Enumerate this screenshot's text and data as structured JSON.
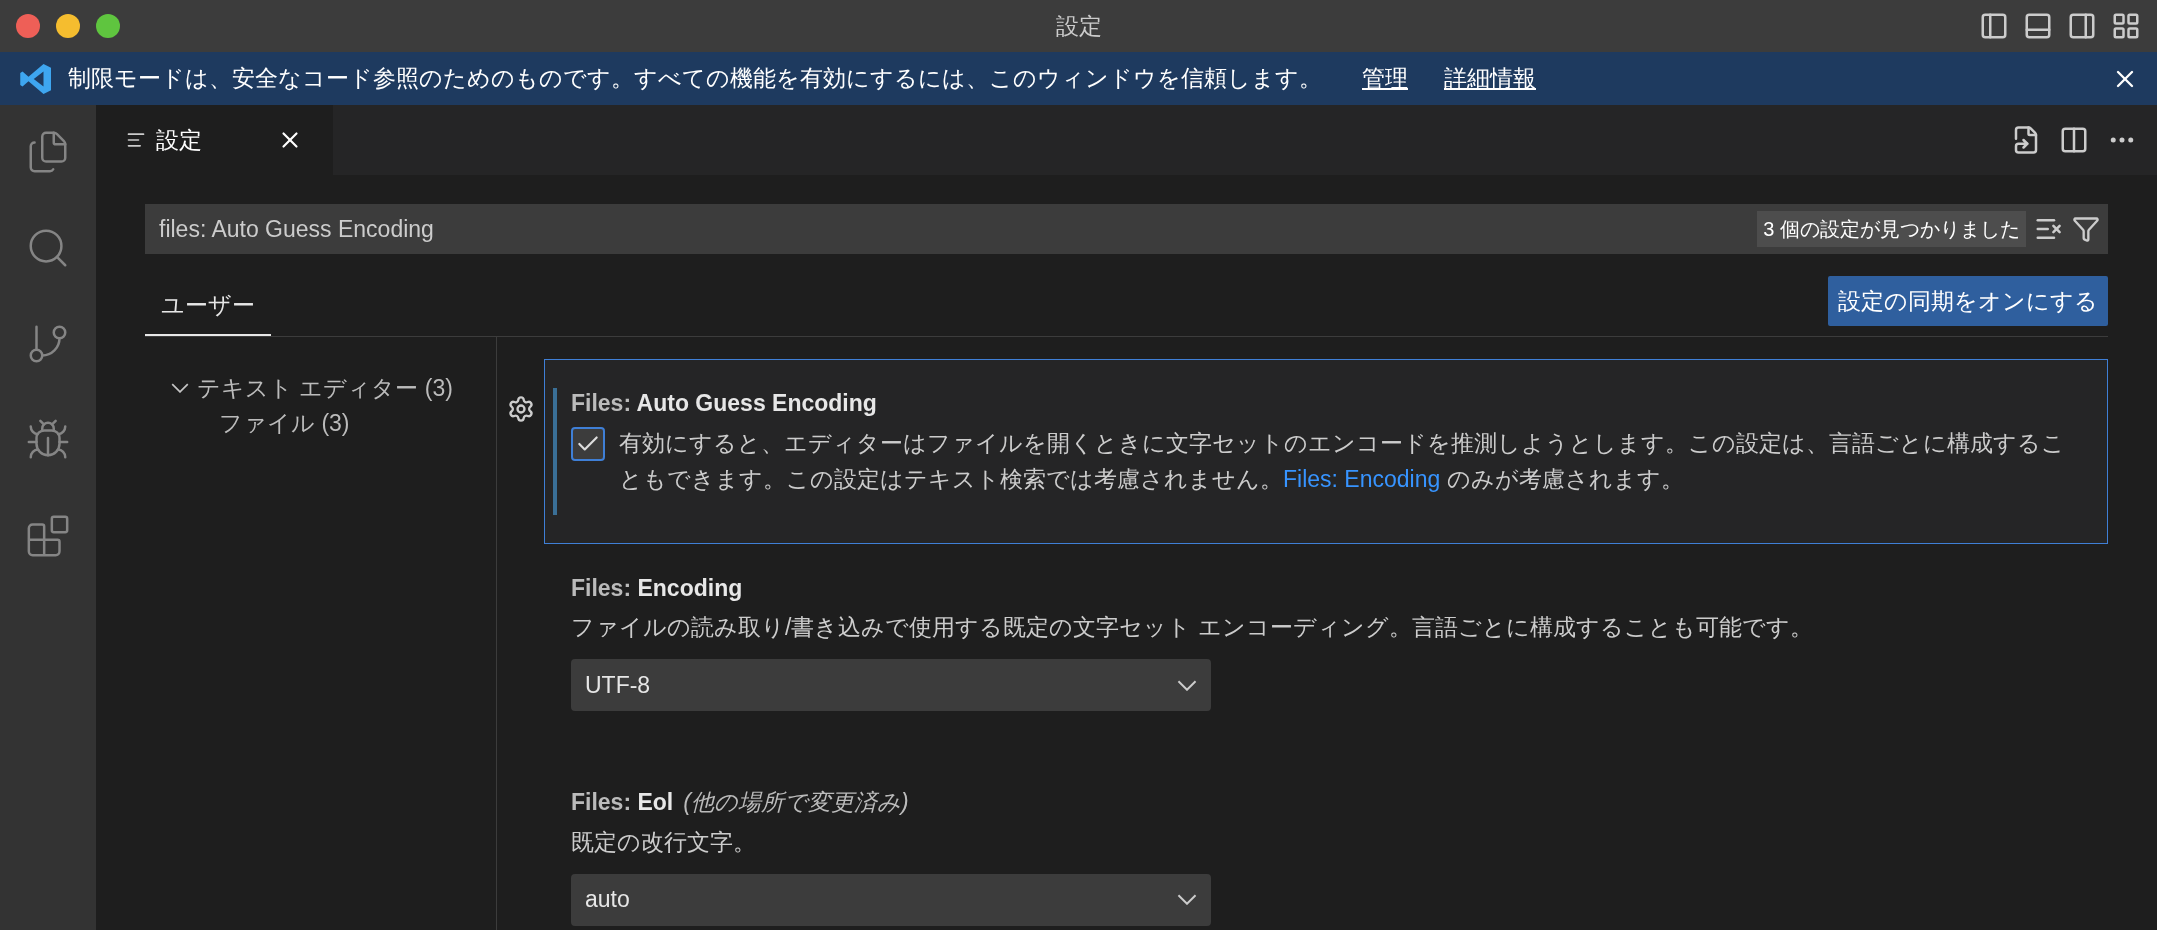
{
  "window": {
    "title": "設定"
  },
  "banner": {
    "message": "制限モードは、安全なコード参照のためのものです。すべての機能を有効にするには、このウィンドウを信頼します。",
    "links": [
      "管理",
      "詳細情報"
    ]
  },
  "editor_tab": {
    "label": "設定"
  },
  "search": {
    "value": "files: Auto Guess Encoding",
    "result_count": "3 個の設定が見つかりました"
  },
  "scope_tabs": [
    {
      "label": "ユーザー",
      "selected": true
    }
  ],
  "sync_button": "設定の同期をオンにする",
  "tree": [
    {
      "label": "テキスト エディター (3)",
      "expanded": true,
      "children": [
        {
          "label": "ファイル (3)"
        }
      ]
    }
  ],
  "settings": [
    {
      "kind": "checkbox",
      "category": "Files: ",
      "name": "Auto Guess Encoding",
      "focused": true,
      "checked": true,
      "description": "有効にすると、エディターはファイルを開くときに文字セットのエンコードを推測しようとします。この設定は、言語ごとに構成することもできます。この設定はテキスト検索では考慮されません。",
      "link": "Files: Encoding",
      "description_after": " のみが考慮されます。"
    },
    {
      "kind": "dropdown",
      "category": "Files: ",
      "name": "Encoding",
      "focused": false,
      "description": "ファイルの読み取り/書き込みで使用する既定の文字セット エンコーディング。言語ごとに構成することも可能です。",
      "value": "UTF-8"
    },
    {
      "kind": "dropdown",
      "category": "Files: ",
      "name": "Eol",
      "modified_note": "(他の場所で変更済み)",
      "focused": false,
      "description": "既定の改行文字。",
      "value": "auto"
    }
  ]
}
